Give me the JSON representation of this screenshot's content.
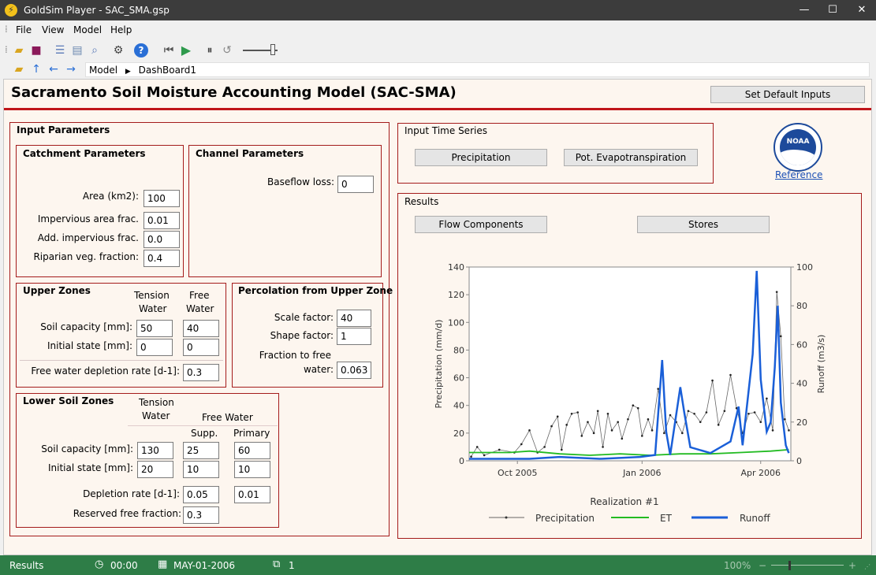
{
  "window": {
    "title": "GoldSim Player - SAC_SMA.gsp",
    "app_icon": "lightning-icon",
    "min": "—",
    "max": "☐",
    "close": "✕"
  },
  "menu": [
    "File",
    "View",
    "Model",
    "Help"
  ],
  "breadcrumb": [
    "Model",
    "DashBoard1"
  ],
  "dashboard": {
    "title": "Sacramento Soil Moisture Accounting Model (SAC-SMA)",
    "set_default": "Set Default Inputs",
    "input_params": {
      "title": "Input Parameters",
      "catchment": {
        "title": "Catchment Parameters",
        "area_label": "Area (km2):",
        "area": "100",
        "imperv_label": "Impervious area frac.",
        "imperv": "0.01",
        "add_imperv_label": "Add. impervious frac.",
        "add_imperv": "0.0",
        "riparian_label": "Riparian veg. fraction:",
        "riparian": "0.4"
      },
      "channel": {
        "title": "Channel Parameters",
        "baseflow_label": "Baseflow loss:",
        "baseflow": "0"
      },
      "upper": {
        "title": "Upper Zones",
        "col_tension": [
          "Tension",
          "Water"
        ],
        "col_free": [
          "Free",
          "Water"
        ],
        "capacity_label": "Soil capacity [mm]:",
        "capacity_tension": "50",
        "capacity_free": "40",
        "initial_label": "Initial state [mm]:",
        "initial_tension": "0",
        "initial_free": "0",
        "depletion_label": "Free water depletion rate [d-1]:",
        "depletion": "0.3"
      },
      "percolation": {
        "title": "Percolation from Upper Zone",
        "scale_label": "Scale factor:",
        "scale": "40",
        "shape_label": "Shape factor:",
        "shape": "1",
        "fraction_label_1": "Fraction to free",
        "fraction_label_2": "water:",
        "fraction": "0.063"
      },
      "lower": {
        "title": "Lower Soil Zones",
        "col_tension": [
          "Tension",
          "Water"
        ],
        "col_free": "Free Water",
        "col_supp": "Supp.",
        "col_primary": "Primary",
        "capacity_label": "Soil capacity [mm]:",
        "capacity_tension": "130",
        "capacity_supp": "25",
        "capacity_primary": "60",
        "initial_label": "Initial state [mm]:",
        "initial_tension": "20",
        "initial_supp": "10",
        "initial_primary": "10",
        "depletion_label": "Depletion rate [d-1]:",
        "depletion_supp": "0.05",
        "depletion_primary": "0.01",
        "reserved_label": "Reserved free fraction:",
        "reserved": "0.3"
      }
    },
    "time_series": {
      "title": "Input Time Series",
      "precip_btn": "Precipitation",
      "pet_btn": "Pot. Evapotranspiration"
    },
    "noaa": {
      "logo_text": "NOAA",
      "reference": "Reference"
    },
    "results": {
      "title": "Results",
      "flow_btn": "Flow Components",
      "stores_btn": "Stores"
    }
  },
  "chart_data": {
    "type": "line",
    "xlabel": "Realization #1",
    "x_ticks": [
      "Oct 2005",
      "Jan 2006",
      "Apr 2006"
    ],
    "y_left": {
      "label": "Precipitation (mm/d)",
      "ticks": [
        "0",
        "20",
        "40",
        "60",
        "80",
        "100",
        "120",
        "140"
      ],
      "lim": [
        0,
        140
      ]
    },
    "y_right": {
      "label": "Runoff (m3/s)",
      "ticks": [
        "0",
        "20",
        "40",
        "60",
        "80",
        "100"
      ],
      "lim": [
        0,
        100
      ]
    },
    "series": [
      {
        "name": "Precipitation",
        "color": "#666666",
        "axis": "left",
        "values": [
          [
            2,
            3
          ],
          [
            8,
            10
          ],
          [
            15,
            4
          ],
          [
            30,
            8
          ],
          [
            45,
            6
          ],
          [
            52,
            12
          ],
          [
            60,
            22
          ],
          [
            68,
            6
          ],
          [
            75,
            10
          ],
          [
            82,
            25
          ],
          [
            88,
            32
          ],
          [
            92,
            8
          ],
          [
            97,
            26
          ],
          [
            102,
            34
          ],
          [
            108,
            35
          ],
          [
            112,
            18
          ],
          [
            118,
            28
          ],
          [
            124,
            20
          ],
          [
            128,
            36
          ],
          [
            133,
            10
          ],
          [
            138,
            34
          ],
          [
            142,
            22
          ],
          [
            148,
            28
          ],
          [
            152,
            16
          ],
          [
            158,
            30
          ],
          [
            163,
            40
          ],
          [
            168,
            38
          ],
          [
            172,
            18
          ],
          [
            178,
            30
          ],
          [
            182,
            22
          ],
          [
            188,
            52
          ],
          [
            194,
            20
          ],
          [
            200,
            33
          ],
          [
            206,
            28
          ],
          [
            212,
            20
          ],
          [
            218,
            36
          ],
          [
            224,
            34
          ],
          [
            230,
            28
          ],
          [
            236,
            35
          ],
          [
            242,
            58
          ],
          [
            248,
            26
          ],
          [
            254,
            36
          ],
          [
            260,
            62
          ],
          [
            266,
            38
          ],
          [
            272,
            20
          ],
          [
            278,
            34
          ],
          [
            284,
            35
          ],
          [
            290,
            28
          ],
          [
            296,
            45
          ],
          [
            302,
            22
          ],
          [
            306,
            122
          ],
          [
            310,
            90
          ],
          [
            314,
            30
          ],
          [
            318,
            22
          ]
        ]
      },
      {
        "name": "ET",
        "color": "#22bb22",
        "axis": "left",
        "values": [
          [
            0,
            6
          ],
          [
            40,
            6
          ],
          [
            60,
            7
          ],
          [
            90,
            5
          ],
          [
            120,
            4
          ],
          [
            150,
            5
          ],
          [
            180,
            4
          ],
          [
            210,
            5
          ],
          [
            240,
            5
          ],
          [
            270,
            6
          ],
          [
            300,
            7
          ],
          [
            318,
            8
          ]
        ]
      },
      {
        "name": "Runoff",
        "color": "#1a5fd8",
        "axis": "right",
        "values": [
          [
            0,
            1
          ],
          [
            60,
            1
          ],
          [
            90,
            2
          ],
          [
            130,
            1
          ],
          [
            170,
            2
          ],
          [
            185,
            3
          ],
          [
            192,
            52
          ],
          [
            196,
            15
          ],
          [
            200,
            3
          ],
          [
            210,
            38
          ],
          [
            214,
            25
          ],
          [
            220,
            7
          ],
          [
            240,
            4
          ],
          [
            260,
            10
          ],
          [
            268,
            28
          ],
          [
            272,
            8
          ],
          [
            282,
            55
          ],
          [
            286,
            98
          ],
          [
            290,
            42
          ],
          [
            296,
            15
          ],
          [
            300,
            20
          ],
          [
            304,
            48
          ],
          [
            307,
            80
          ],
          [
            310,
            30
          ],
          [
            315,
            8
          ],
          [
            318,
            4
          ]
        ]
      }
    ],
    "legend": [
      "Precipitation",
      "ET",
      "Runoff"
    ],
    "legend_position": "bottom",
    "grid": false
  },
  "status": {
    "mode": "Results",
    "time": "00:00",
    "date": "MAY-01-2006",
    "realization": "1",
    "zoom": "100%"
  }
}
